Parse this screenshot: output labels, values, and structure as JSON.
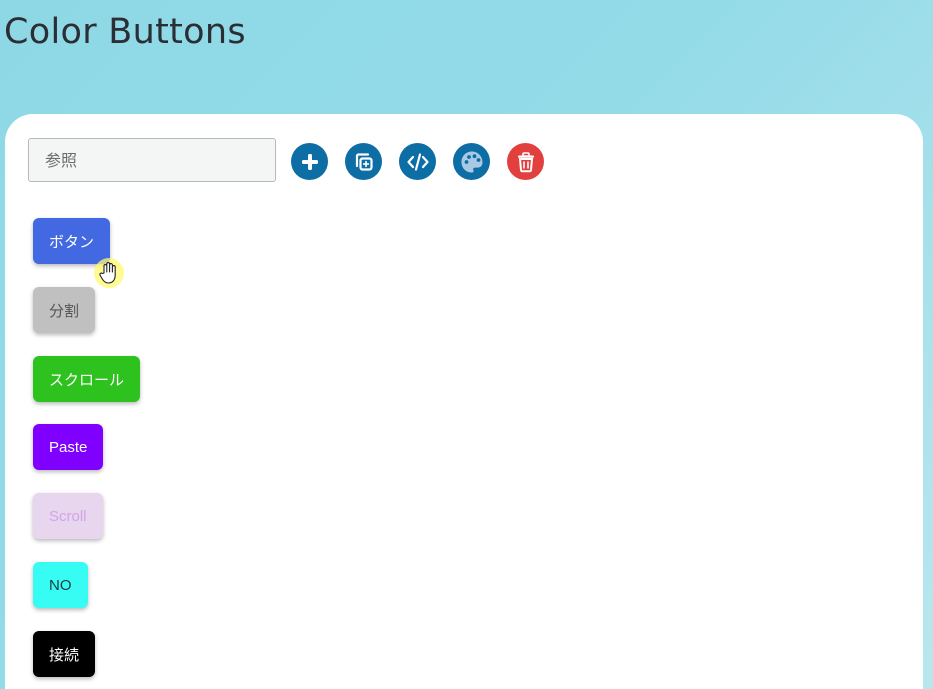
{
  "page": {
    "title": "Color Buttons"
  },
  "toolbar": {
    "search_placeholder": "参照",
    "search_value": "",
    "tools": [
      {
        "icon": "plus-icon",
        "color": "#0d6ea6"
      },
      {
        "icon": "duplicate-icon",
        "color": "#0d6ea6"
      },
      {
        "icon": "code-icon",
        "color": "#0d6ea6"
      },
      {
        "icon": "palette-icon",
        "color": "#0d6ea6"
      },
      {
        "icon": "trash-icon",
        "color": "#e2403f"
      }
    ]
  },
  "buttons": [
    {
      "label": "ボタン",
      "bg": "#4269e2",
      "fg": "#ffffff"
    },
    {
      "label": "分割",
      "bg": "#c0c0c0",
      "fg": "#555555"
    },
    {
      "label": "スクロール",
      "bg": "#2ec21f",
      "fg": "#ffffff"
    },
    {
      "label": "Paste",
      "bg": "#7f00ff",
      "fg": "#ffffff"
    },
    {
      "label": "Scroll",
      "bg": "#e8d5ee",
      "fg": "#d3a3e8"
    },
    {
      "label": "NO",
      "bg": "#36fcf4",
      "fg": "#1d3b3b"
    },
    {
      "label": "接続",
      "bg": "#000000",
      "fg": "#ffffff"
    }
  ]
}
